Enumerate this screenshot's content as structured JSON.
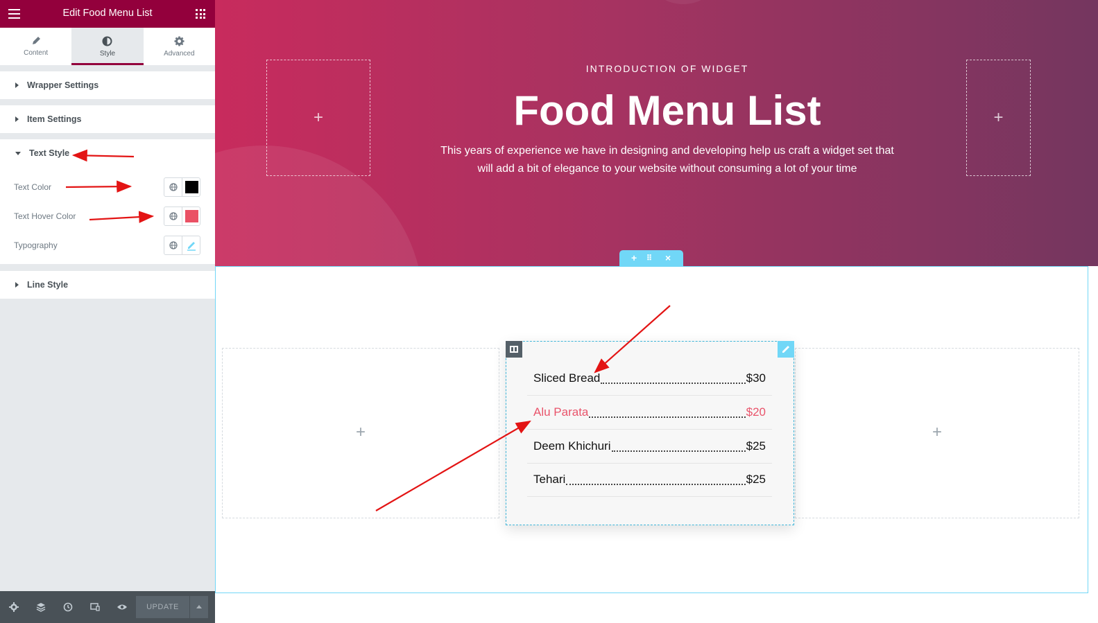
{
  "editor": {
    "title": "Edit Food Menu List",
    "tabs": [
      {
        "label": "Content",
        "icon": "pencil-icon"
      },
      {
        "label": "Style",
        "icon": "contrast-icon"
      },
      {
        "label": "Advanced",
        "icon": "gear-icon"
      }
    ],
    "active_tab": "Style",
    "sections": {
      "wrapper": "Wrapper Settings",
      "item": "Item Settings",
      "text_style": "Text Style",
      "line_style": "Line Style"
    },
    "controls": {
      "text_color": {
        "label": "Text Color",
        "value": "#000000"
      },
      "text_hover_color": {
        "label": "Text Hover Color",
        "value": "#ea5165"
      },
      "typography": {
        "label": "Typography"
      }
    },
    "footer": {
      "update_label": "UPDATE"
    }
  },
  "hero": {
    "eyebrow": "INTRODUCTION OF WIDGET",
    "title": "Food Menu List",
    "description": "This years of experience we have in designing and developing help us craft a widget set that will add a bit of elegance to your website without consuming a lot of your time"
  },
  "menu": {
    "items": [
      {
        "name": "Sliced Bread",
        "price": "$30",
        "state": "normal"
      },
      {
        "name": "Alu Parata",
        "price": "$20",
        "state": "hover"
      },
      {
        "name": "Deem Khichuri",
        "price": "$25",
        "state": "normal"
      },
      {
        "name": "Tehari",
        "price": "$25",
        "state": "normal"
      }
    ]
  },
  "colors": {
    "brand": "#93003c",
    "hover_text": "#e9546b",
    "editor_accent": "#71d7f7",
    "annotation_arrow": "#e31414"
  }
}
